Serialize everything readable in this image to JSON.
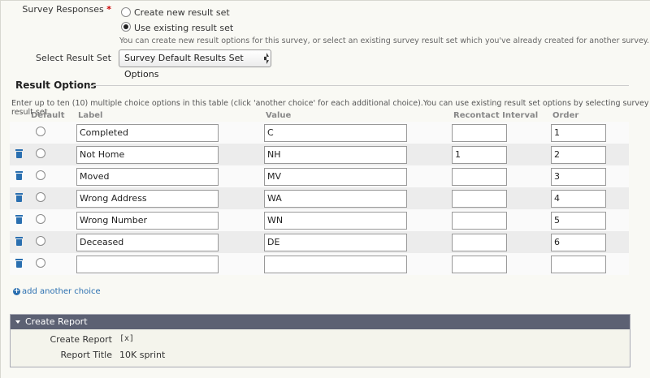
{
  "survey_responses": {
    "label": "Survey Responses",
    "required_mark": "*",
    "options": [
      {
        "label": "Create new result set",
        "selected": false
      },
      {
        "label": "Use existing result set",
        "selected": true
      }
    ],
    "help": "You can create new result options for this survey, or select an existing survey result set which you've already created for another survey."
  },
  "select_result_set": {
    "label": "Select Result Set",
    "value": "Survey Default Results Set Options"
  },
  "result_options": {
    "title": "Result Options",
    "help": "Enter up to ten (10) multiple choice options in this table (click 'another choice' for each additional choice).You can use existing result set options by selecting survey result set.",
    "columns": {
      "default": "Default",
      "label": "Label",
      "value": "Value",
      "recontact": "Recontact Interval",
      "order": "Order"
    },
    "rows": [
      {
        "label": "Completed",
        "value": "C",
        "recontact": "",
        "order": "1",
        "deletable": false
      },
      {
        "label": "Not Home",
        "value": "NH",
        "recontact": "1",
        "order": "2",
        "deletable": true
      },
      {
        "label": "Moved",
        "value": "MV",
        "recontact": "",
        "order": "3",
        "deletable": true
      },
      {
        "label": "Wrong Address",
        "value": "WA",
        "recontact": "",
        "order": "4",
        "deletable": true
      },
      {
        "label": "Wrong Number",
        "value": "WN",
        "recontact": "",
        "order": "5",
        "deletable": true
      },
      {
        "label": "Deceased",
        "value": "DE",
        "recontact": "",
        "order": "6",
        "deletable": true
      },
      {
        "label": "",
        "value": "",
        "recontact": "",
        "order": "",
        "deletable": true
      }
    ],
    "add_choice": "add another choice"
  },
  "create_report": {
    "header": "Create Report",
    "fields": [
      {
        "label": "Create Report",
        "value": "[x]"
      },
      {
        "label": "Report Title",
        "value": "10K sprint"
      }
    ]
  }
}
